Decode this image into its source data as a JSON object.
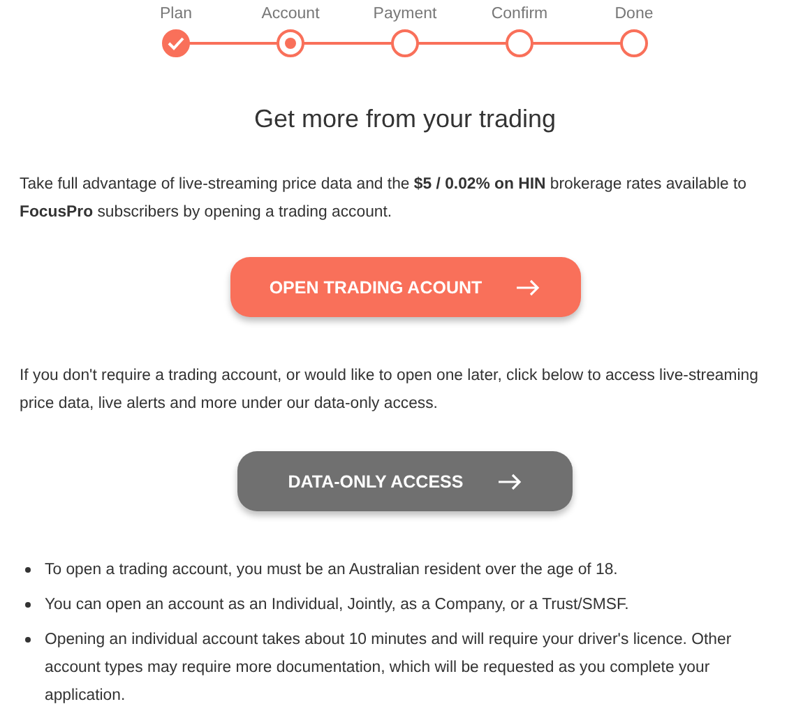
{
  "steps": [
    {
      "label": "Plan",
      "kind": "done"
    },
    {
      "label": "Account",
      "kind": "current"
    },
    {
      "label": "Payment",
      "kind": "upcoming"
    },
    {
      "label": "Confirm",
      "kind": "upcoming"
    },
    {
      "label": "Done",
      "kind": "upcoming"
    }
  ],
  "title": "Get more from your trading",
  "intro": "Take full advantage of live-streaming price data and the **$5 / 0.02% on HIN** brokerage rates available to **FocusPro** subscribers by opening a trading account.",
  "primary_button": {
    "label": "OPEN TRADING ACOUNT",
    "kind": "primary"
  },
  "data_only_text": "If you don't require a trading account, or would like to open one later, click below to access live-streaming price data, live alerts and more under our data-only access.",
  "secondary_button": {
    "label": "DATA-ONLY ACCESS",
    "kind": "secondary"
  },
  "notes": [
    "To open a trading account, you must be an Australian resident over the age of 18.",
    "You can open an account as an Individual, Jointly, as a Company, or a Trust/SMSF.",
    "Opening an individual account takes about 10 minutes and will require your driver's licence. Other account types may require more documentation, which will be requested as you complete your application."
  ]
}
